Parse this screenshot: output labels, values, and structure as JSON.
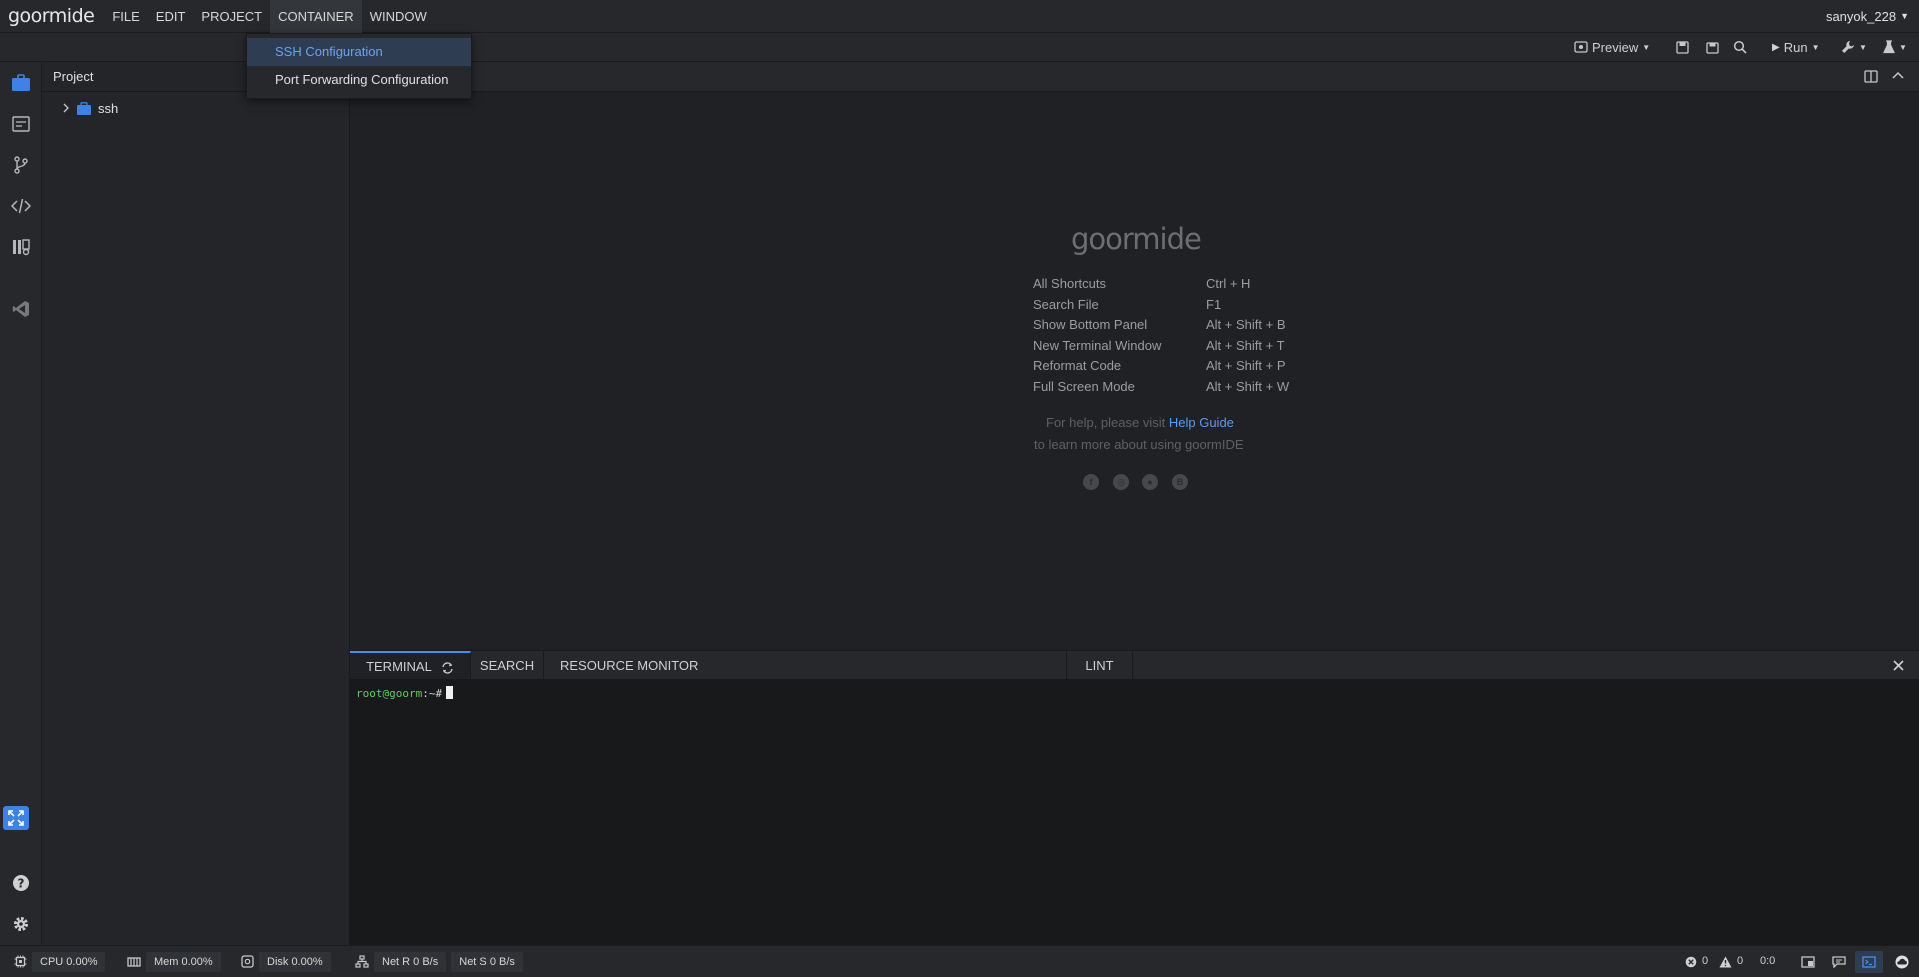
{
  "app": {
    "logo": "goormide",
    "user": "sanyok_228"
  },
  "menubar": {
    "items": [
      "FILE",
      "EDIT",
      "PROJECT",
      "CONTAINER",
      "WINDOW"
    ]
  },
  "dropdown": {
    "items": [
      "SSH Configuration",
      "Port Forwarding Configuration"
    ]
  },
  "toolbar": {
    "preview_label": "Preview",
    "run_label": "Run"
  },
  "project_panel": {
    "title": "Project",
    "tree": [
      {
        "label": "ssh",
        "type": "folder"
      }
    ]
  },
  "welcome": {
    "logo": "goormide",
    "shortcuts": [
      {
        "label": "All Shortcuts",
        "key": "Ctrl + H"
      },
      {
        "label": "Search File",
        "key": "F1"
      },
      {
        "label": "Show Bottom Panel",
        "key": "Alt + Shift + B"
      },
      {
        "label": "New Terminal Window",
        "key": "Alt + Shift + T"
      },
      {
        "label": "Reformat Code",
        "key": "Alt + Shift + P"
      },
      {
        "label": "Full Screen Mode",
        "key": "Alt + Shift + W"
      }
    ],
    "help_prefix": "For help, please visit",
    "help_link": "Help Guide",
    "learn_more": "to learn more about using goormIDE",
    "social": [
      "facebook-icon",
      "instagram-icon",
      "github-icon",
      "blog-icon"
    ]
  },
  "bottom_panel": {
    "tabs": [
      "TERMINAL",
      "SEARCH",
      "RESOURCE MONITOR",
      "LINT"
    ],
    "active_tab": "TERMINAL"
  },
  "terminal": {
    "user_host": "root@goorm",
    "path": ":~#"
  },
  "statusbar": {
    "cpu": "CPU 0.00%",
    "mem": "Mem 0.00%",
    "disk": "Disk 0.00%",
    "net_r": "Net R 0 B/s",
    "net_s": "Net S 0 B/s",
    "errors": "0",
    "warnings": "0",
    "cursor_pos": "0:0"
  },
  "colors": {
    "accent": "#4a8df0",
    "highlight_text": "#6aa4ef",
    "terminal_user": "#5cd05c"
  }
}
